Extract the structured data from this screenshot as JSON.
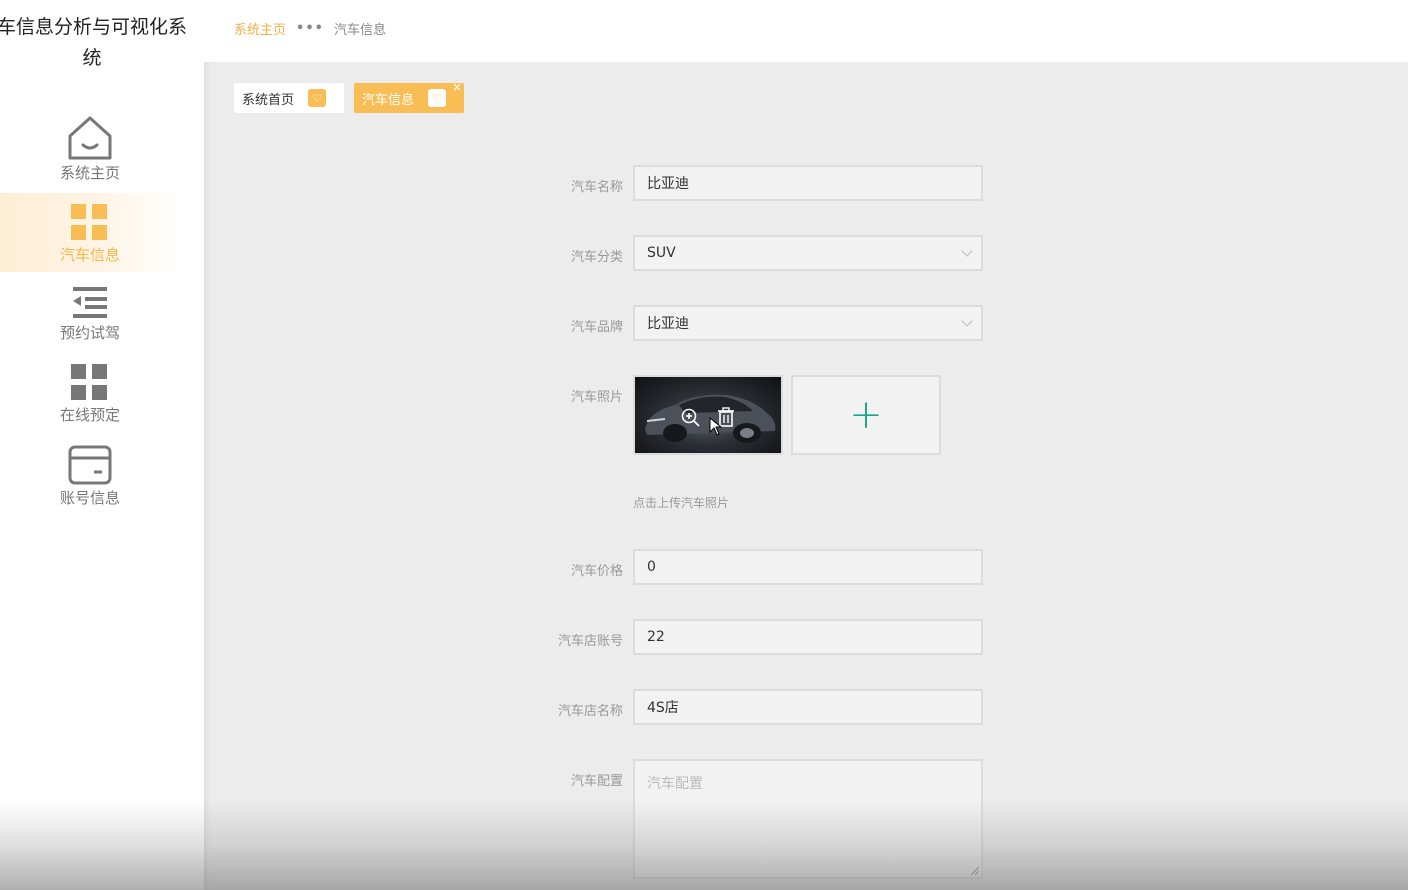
{
  "app": {
    "title": "车信息分析与可视化系统"
  },
  "sidebar": {
    "items": [
      {
        "label": "系统主页",
        "icon": "house-icon",
        "active": false
      },
      {
        "label": "汽车信息",
        "icon": "grid-icon",
        "active": true
      },
      {
        "label": "预约试驾",
        "icon": "list-indent-icon",
        "active": false
      },
      {
        "label": "在线预定",
        "icon": "grid-icon",
        "active": false
      },
      {
        "label": "账号信息",
        "icon": "card-icon",
        "active": false
      }
    ]
  },
  "breadcrumb": {
    "home": "系统主页",
    "separator": "•••",
    "current": "汽车信息"
  },
  "tabs": [
    {
      "label": "系统首页",
      "icon": "heart-icon",
      "closable": false
    },
    {
      "label": "汽车信息",
      "icon": "heart-icon",
      "closable": true,
      "close_symbol": "×"
    }
  ],
  "form": {
    "car_name": {
      "label": "汽车名称",
      "value": "比亚迪"
    },
    "car_category": {
      "label": "汽车分类",
      "value": "SUV"
    },
    "car_brand": {
      "label": "汽车品牌",
      "value": "比亚迪"
    },
    "car_photo": {
      "label": "汽车照片",
      "hint": "点击上传汽车照片",
      "upload_symbol": "+"
    },
    "car_price": {
      "label": "汽车价格",
      "value": "0"
    },
    "shop_account": {
      "label": "汽车店账号",
      "value": "22"
    },
    "shop_name": {
      "label": "汽车店名称",
      "value": "4S店"
    },
    "car_config": {
      "label": "汽车配置",
      "placeholder": "汽车配置"
    }
  },
  "colors": {
    "accent": "#f8bd54",
    "accent_text": "#f3b04a",
    "upload_plus": "#1aa58c",
    "page_bg": "#ececec"
  }
}
